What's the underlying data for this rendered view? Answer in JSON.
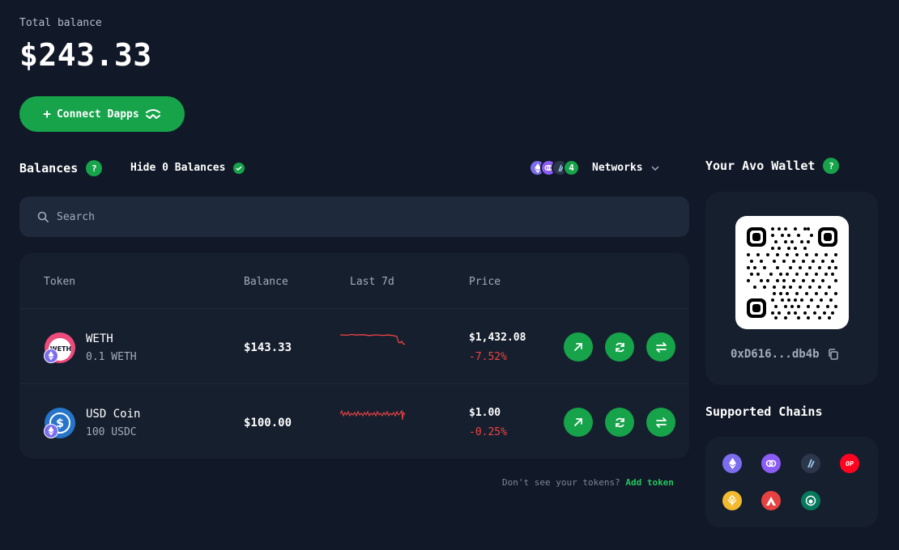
{
  "header": {
    "total_label": "Total balance",
    "total_value": "$243.33",
    "connect_label": "Connect Dapps"
  },
  "balances": {
    "title": "Balances",
    "help": "?",
    "hide_zero_label": "Hide 0 Balances",
    "networks_count": "4",
    "networks_label": "Networks"
  },
  "search": {
    "placeholder": "Search"
  },
  "table": {
    "columns": [
      "Token",
      "Balance",
      "Last 7d",
      "Price"
    ],
    "rows": [
      {
        "name": "WETH",
        "amount": "0.1 WETH",
        "balance": "$143.33",
        "price": "$1,432.08",
        "change": "-7.52%",
        "icon_label": "WETH"
      },
      {
        "name": "USD Coin",
        "amount": "100 USDC",
        "balance": "$100.00",
        "price": "$1.00",
        "change": "-0.25%",
        "icon_label": "$"
      }
    ]
  },
  "footer": {
    "note": "Don't see your tokens?",
    "add_token": "Add token"
  },
  "wallet": {
    "title": "Your Avo Wallet",
    "help": "?",
    "address": "0xD616...db4b"
  },
  "chains": {
    "title": "Supported Chains",
    "items": [
      {
        "name": "ethereum",
        "color": "#7c6cf0"
      },
      {
        "name": "polygon",
        "color": "#8b5cf6"
      },
      {
        "name": "arbitrum",
        "color": "#2d374b"
      },
      {
        "name": "optimism",
        "color": "#ff0420",
        "label": "OP"
      },
      {
        "name": "bnb",
        "color": "#f3ba2f"
      },
      {
        "name": "avalanche",
        "color": "#e84142"
      },
      {
        "name": "gnosis",
        "color": "#04795b"
      }
    ]
  },
  "colors": {
    "accent": "#16a34a",
    "negative": "#ef4444",
    "background": "#111827",
    "card": "#161f2e"
  }
}
